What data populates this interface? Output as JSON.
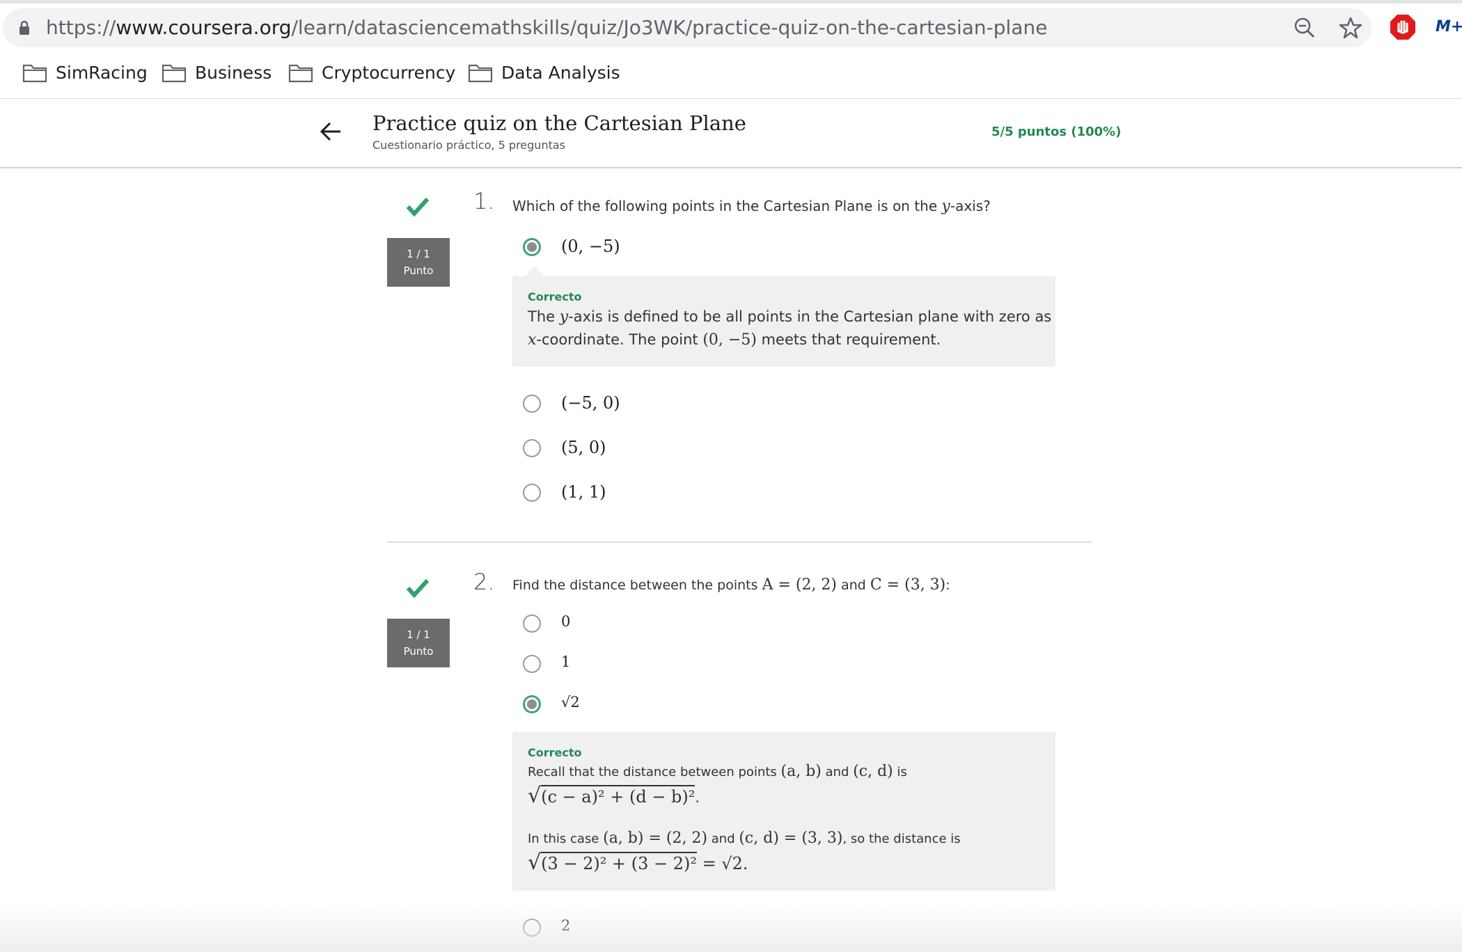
{
  "browser": {
    "url_prefix": "https://",
    "url_host": "www.coursera.org",
    "url_path": "/learn/datasciencemathskills/quiz/Jo3WK/practice-quiz-on-the-cartesian-plane",
    "icons": [
      "lock-icon",
      "zoom-icon",
      "star-icon",
      "adblock-stop-icon",
      "movistar-extension-icon"
    ],
    "ext_m_label": "M+",
    "bookmarks": [
      {
        "label": "SimRacing",
        "icon": "folder-icon"
      },
      {
        "label": "Business",
        "icon": "folder-icon"
      },
      {
        "label": "Cryptocurrency",
        "icon": "folder-icon"
      },
      {
        "label": "Data Analysis",
        "icon": "folder-icon"
      }
    ]
  },
  "quiz": {
    "title": "Practice quiz on the Cartesian Plane",
    "subtitle": "Cuestionario práctico, 5 preguntas",
    "score": "5/5 puntos (100%)",
    "accent_color": "#1f8a55"
  },
  "questions": [
    {
      "number": "1.",
      "points_line1": "1 / 1",
      "points_line2": "Punto",
      "text_before": "Which of the following points in the Cartesian Plane is on the ",
      "text_var": "y",
      "text_after": "-axis?",
      "options": [
        {
          "label": "(0, −5)",
          "selected": true
        },
        {
          "label": "(−5, 0)",
          "selected": false
        },
        {
          "label": "(5, 0)",
          "selected": false
        },
        {
          "label": "(1, 1)",
          "selected": false
        }
      ],
      "feedback": {
        "status": "Correcto",
        "line1_a": "The ",
        "line1_var": "y",
        "line1_b": "-axis is defined to be all points in the Cartesian plane with zero as",
        "line2_var": "x",
        "line2_a": "-coordinate. The point ",
        "line2_math": "(0, −5)",
        "line2_b": " meets that requirement."
      }
    },
    {
      "number": "2.",
      "points_line1": "1 / 1",
      "points_line2": "Punto",
      "text_a": "Find the distance between the points ",
      "text_m1": "A = (2, 2)",
      "text_b": " and ",
      "text_m2": "C = (3, 3)",
      "text_c": ":",
      "options": [
        {
          "label": "0",
          "selected": false
        },
        {
          "label": "1",
          "selected": false
        },
        {
          "label": "√2",
          "selected": true
        },
        {
          "label": "2",
          "selected": false
        }
      ],
      "feedback": {
        "status": "Correcto",
        "line1_a": "Recall that the distance between points ",
        "line1_m1": "(a, b)",
        "line1_b": " and ",
        "line1_m2": "(c, d)",
        "line1_c": " is",
        "formula": "(c − a)² + (d − b)²",
        "formula_end": ".",
        "line3_a": "In this case ",
        "line3_m1": "(a, b) = (2, 2)",
        "line3_b": " and ",
        "line3_m2": "(c, d) = (3, 3)",
        "line3_c": ", so the distance is",
        "formula2": "(3 − 2)² + (3 − 2)²",
        "formula2_end": " = √2."
      }
    }
  ]
}
